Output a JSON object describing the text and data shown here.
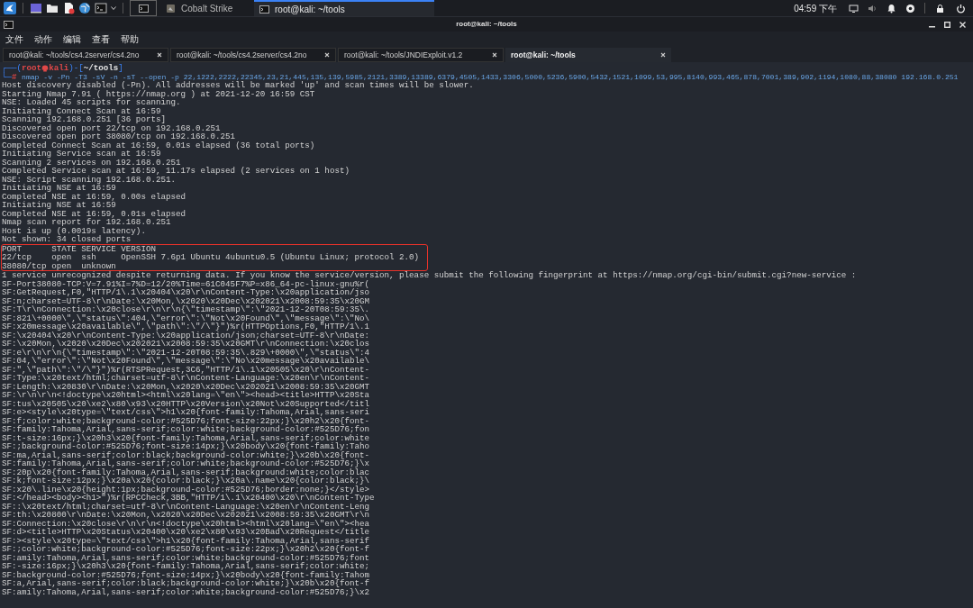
{
  "panel": {
    "launchers": [
      {
        "kind": "desktop"
      },
      {
        "kind": "folder"
      },
      {
        "kind": "editor"
      },
      {
        "kind": "browser"
      },
      {
        "kind": "terminal"
      }
    ],
    "windows": [
      {
        "kind": "terminal",
        "selected": false
      },
      {
        "label": "Cobalt Strike",
        "kind": "app",
        "selected": false
      },
      {
        "label": "root@kali: ~/tools",
        "kind": "terminal",
        "selected": true
      }
    ],
    "clock": "04:59 下午"
  },
  "window": {
    "title": "root@kali: ~/tools"
  },
  "menu": [
    "文件",
    "动作",
    "编辑",
    "查看",
    "帮助"
  ],
  "tabs": [
    {
      "label": "root@kali: ~/tools/cs4.2server/cs4.2no",
      "selected": false
    },
    {
      "label": "root@kali: ~/tools/cs4.2server/cs4.2no",
      "selected": false
    },
    {
      "label": "root@kali: ~/tools/JNDIExploit.v1.2",
      "selected": false
    },
    {
      "label": "root@kali: ~/tools",
      "selected": true
    }
  ],
  "prompt": {
    "open": "┌──(",
    "user": "root",
    "host": "kali",
    "mid": ")-[",
    "path": "~/tools",
    "close": "]",
    "corner": "└─",
    "sign": "#",
    "command": "nmap -v -Pn -T3 -sV -n -sT --open -p 22,1222,2222,22345,23,21,445,135,139,5985,2121,3389,13389,6379,4505,1433,3306,5000,5236,5900,5432,1521,1099,53,995,8140,993,465,878,7001,389,902,1194,1080,88,38080 192.168.0.251"
  },
  "lines_before": [
    "Host discovery disabled (-Pn). All addresses will be marked 'up' and scan times will be slower.",
    "Starting Nmap 7.91 ( https://nmap.org ) at 2021-12-20 16:59 CST",
    "NSE: Loaded 45 scripts for scanning.",
    "Initiating Connect Scan at 16:59",
    "Scanning 192.168.0.251 [36 ports]",
    "Discovered open port 22/tcp on 192.168.0.251",
    "Discovered open port 38080/tcp on 192.168.0.251",
    "Completed Connect Scan at 16:59, 0.01s elapsed (36 total ports)",
    "Initiating Service scan at 16:59",
    "Scanning 2 services on 192.168.0.251",
    "Completed Service scan at 16:59, 11.17s elapsed (2 services on 1 host)",
    "NSE: Script scanning 192.168.0.251.",
    "Initiating NSE at 16:59",
    "Completed NSE at 16:59, 0.00s elapsed",
    "Initiating NSE at 16:59",
    "Completed NSE at 16:59, 0.01s elapsed",
    "Nmap scan report for 192.168.0.251",
    "Host is up (0.0019s latency).",
    "Not shown: 34 closed ports"
  ],
  "boxed_lines": [
    "PORT      STATE SERVICE VERSION",
    "22/tcp    open  ssh     OpenSSH 7.6p1 Ubuntu 4ubuntu0.5 (Ubuntu Linux; protocol 2.0)",
    "38080/tcp open  unknown"
  ],
  "lines_after": [
    "1 service unrecognized despite returning data. If you know the service/version, please submit the following fingerprint at https://nmap.org/cgi-bin/submit.cgi?new-service :",
    "SF-Port38080-TCP:V=7.91%I=7%D=12/20%Time=61C045F7%P=x86_64-pc-linux-gnu%r(",
    "SF:GetRequest,F0,\"HTTP/1\\.1\\x20404\\x20\\r\\nContent-Type:\\x20application/jso",
    "SF:n;charset=UTF-8\\r\\nDate:\\x20Mon,\\x2020\\x20Dec\\x202021\\x2008:59:35\\x20GM",
    "SF:T\\r\\nConnection:\\x20close\\r\\n\\r\\n{\\\"timestamp\\\":\\\"2021-12-20T08:59:35\\.",
    "SF:821\\+0000\\\",\\\"status\\\":404,\\\"error\\\":\\\"Not\\x20Found\\\",\\\"message\\\":\\\"No\\",
    "SF:x20message\\x20available\\\",\\\"path\\\":\\\"/\\\"}\")%r(HTTPOptions,F0,\"HTTP/1\\.1",
    "SF:\\x20404\\x20\\r\\nContent-Type:\\x20application/json;charset=UTF-8\\r\\nDate:",
    "SF:\\x20Mon,\\x2020\\x20Dec\\x202021\\x2008:59:35\\x20GMT\\r\\nConnection:\\x20clos",
    "SF:e\\r\\n\\r\\n{\\\"timestamp\\\":\\\"2021-12-20T08:59:35\\.829\\+0000\\\",\\\"status\\\":4",
    "SF:04,\\\"error\\\":\\\"Not\\x20Found\\\",\\\"message\\\":\\\"No\\x20message\\x20available\\",
    "SF:\",\\\"path\\\":\\\"/\\\"}\")%r(RTSPRequest,3C6,\"HTTP/1\\.1\\x20505\\x20\\r\\nContent-",
    "SF:Type:\\x20text/html;charset=utf-8\\r\\nContent-Language:\\x20en\\r\\nContent-",
    "SF:Length:\\x20830\\r\\nDate:\\x20Mon,\\x2020\\x20Dec\\x202021\\x2008:59:35\\x20GMT",
    "SF:\\r\\n\\r\\n<!doctype\\x20html><html\\x20lang=\\\"en\\\"><head><title>HTTP\\x20Sta",
    "SF:tus\\x20505\\x20\\xe2\\x80\\x93\\x20HTTP\\x20Version\\x20Not\\x20Supported</titl",
    "SF:e><style\\x20type=\\\"text/css\\\">h1\\x20{font-family:Tahoma,Arial,sans-seri",
    "SF:f;color:white;background-color:#525D76;font-size:22px;}\\x20h2\\x20{font-",
    "SF:family:Tahoma,Arial,sans-serif;color:white;background-color:#525D76;fon",
    "SF:t-size:16px;}\\x20h3\\x20{font-family:Tahoma,Arial,sans-serif;color:white",
    "SF:;background-color:#525D76;font-size:14px;}\\x20body\\x20{font-family:Taho",
    "SF:ma,Arial,sans-serif;color:black;background-color:white;}\\x20b\\x20{font-",
    "SF:family:Tahoma,Arial,sans-serif;color:white;background-color:#525D76;}\\x",
    "SF:20p\\x20{font-family:Tahoma,Arial,sans-serif;background:white;color:blac",
    "SF:k;font-size:12px;}\\x20a\\x20{color:black;}\\x20a\\.name\\x20{color:black;}\\",
    "SF:x20\\.line\\x20{height:1px;background-color:#525D76;border:none;}</style>",
    "SF:</head><body><h1>\")%r(RPCCheck,3BB,\"HTTP/1\\.1\\x20400\\x20\\r\\nContent-Type",
    "SF::\\x20text/html;charset=utf-8\\r\\nContent-Language:\\x20en\\r\\nContent-Leng",
    "SF:th:\\x20800\\r\\nDate:\\x20Mon,\\x2020\\x20Dec\\x202021\\x2008:59:35\\x20GMT\\r\\n",
    "SF:Connection:\\x20close\\r\\n\\r\\n<!doctype\\x20html><html\\x20lang=\\\"en\\\"><hea",
    "SF:d><title>HTTP\\x20Status\\x20400\\x20\\xe2\\x80\\x93\\x20Bad\\x20Request</title",
    "SF:><style\\x20type=\\\"text/css\\\">h1\\x20{font-family:Tahoma,Arial,sans-serif",
    "SF:;color:white;background-color:#525D76;font-size:22px;}\\x20h2\\x20{font-f",
    "SF:amily:Tahoma,Arial,sans-serif;color:white;background-color:#525D76;font",
    "SF:-size:16px;}\\x20h3\\x20{font-family:Tahoma,Arial,sans-serif;color:white;",
    "SF:background-color:#525D76;font-size:14px;}\\x20body\\x20{font-family:Tahom",
    "SF:a,Arial,sans-serif;color:black;background-color:white;}\\x20b\\x20{font-f",
    "SF:amily:Tahoma,Arial,sans-serif;color:white;background-color:#525D76;}\\x2"
  ]
}
